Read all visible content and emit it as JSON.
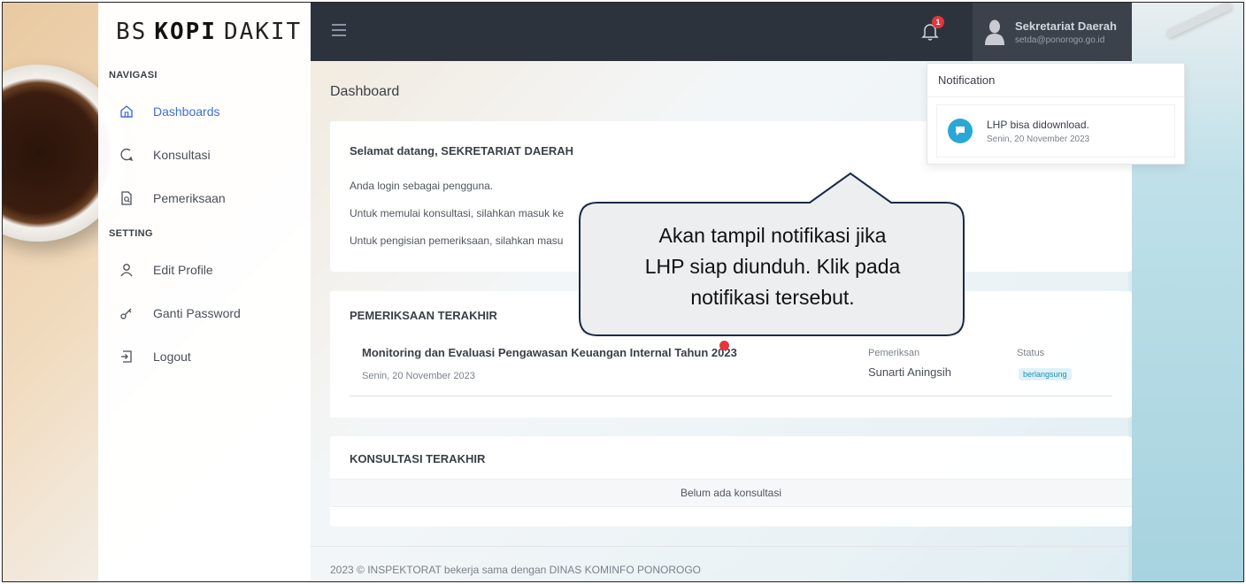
{
  "app": {
    "logo_left": "BS",
    "logo_mid": "KOPI",
    "logo_right": "DAKIT"
  },
  "sidebar": {
    "section_nav": "NAVIGASI",
    "section_setting": "SETTING",
    "items": [
      {
        "label": "Dashboards",
        "icon": "home-icon",
        "active": true
      },
      {
        "label": "Konsultasi",
        "icon": "chat-icon"
      },
      {
        "label": "Pemeriksaan",
        "icon": "document-search-icon"
      },
      {
        "label": "Edit Profile",
        "icon": "user-icon"
      },
      {
        "label": "Ganti Password",
        "icon": "key-icon"
      },
      {
        "label": "Logout",
        "icon": "logout-icon"
      }
    ]
  },
  "topbar": {
    "notification_count": "1",
    "user_name": "Sekretariat Daerah",
    "user_email": "setda@ponorogo.go.id"
  },
  "notification": {
    "header": "Notification",
    "item_text": "LHP bisa didownload.",
    "item_date": "Senin, 20 November 2023"
  },
  "page": {
    "title": "Dashboard"
  },
  "welcome": {
    "title": "Selamat datang, SEKRETARIAT DAERAH",
    "line1": "Anda login sebagai pengguna.",
    "line2": "Untuk memulai konsultasi, silahkan masuk ke",
    "line3": "Untuk pengisian pemeriksaan, silahkan masu"
  },
  "pemeriksaan": {
    "title": "PEMERIKSAAN TERAKHIR",
    "row_title": "Monitoring dan Evaluasi Pengawasan Keuangan Internal Tahun 2023",
    "row_date": "Senin, 20 November 2023",
    "col_pemeriksa_label": "Pemeriksan",
    "col_pemeriksa_value": "Sunarti Aningsih",
    "col_status_label": "Status",
    "col_status_value": "berlangsung"
  },
  "konsultasi": {
    "title": "KONSULTASI TERAKHIR",
    "empty": "Belum ada konsultasi"
  },
  "footer": {
    "text": "2023 © INSPEKTORAT bekerja sama dengan DINAS KOMINFO PONOROGO"
  },
  "callout": {
    "line1": "Akan tampil notifikasi jika",
    "line2": "LHP siap diunduh. Klik pada",
    "line3": "notifikasi tersebut."
  },
  "colors": {
    "topbar": "#2d333d",
    "accent": "#3d6fd6",
    "badge": "#e5363c",
    "notif_icon": "#2aa7d6"
  }
}
